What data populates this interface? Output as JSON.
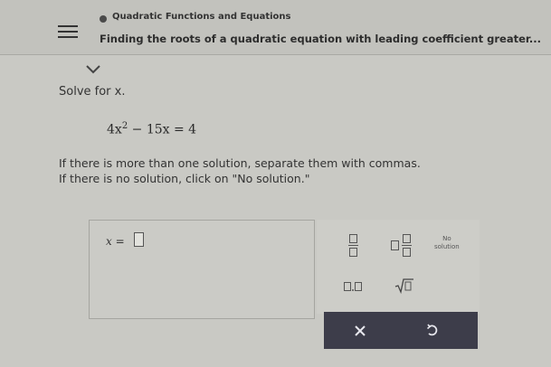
{
  "header": {
    "topic": "Quadratic Functions and Equations",
    "lesson_title": "Finding the roots of a quadratic equation with leading coefficient greater..."
  },
  "problem": {
    "instruction": "Solve for x.",
    "equation_lhs_a": "4x",
    "equation_exponent": "2",
    "equation_rest": " − 15x = 4",
    "note_multiple": "If there is more than one solution, separate them with commas.",
    "note_none": "If there is no solution, click on \"No solution.\""
  },
  "answer": {
    "label": "x ="
  },
  "palette": {
    "no_solution_line1": "No",
    "no_solution_line2": "solution"
  },
  "colors": {
    "background": "#c9c9c4",
    "action_bar": "#3d3d4a"
  }
}
